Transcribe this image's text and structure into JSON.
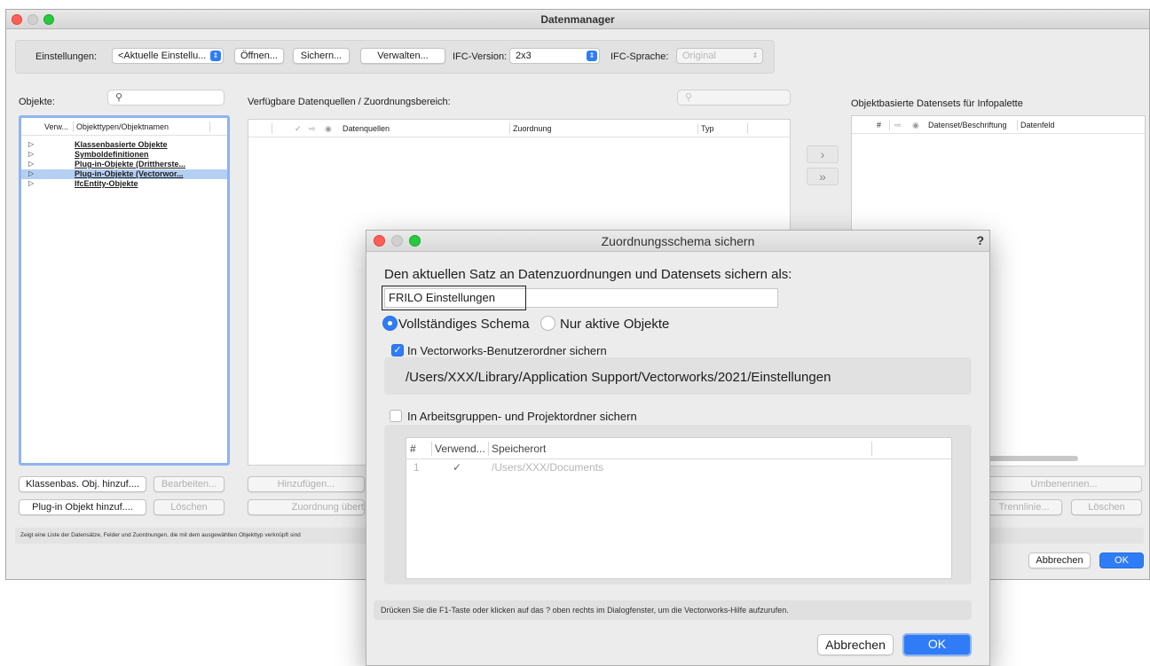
{
  "main_window": {
    "title": "Datenmanager",
    "settings": {
      "label": "Einstellungen:",
      "current": "<Aktuelle Einstellu...",
      "open_label": "Öffnen...",
      "save_label": "Sichern...",
      "manage_label": "Verwalten...",
      "ifc_version_label": "IFC-Version:",
      "ifc_version_value": "2x3",
      "ifc_language_label": "IFC-Sprache:",
      "ifc_language_value": "Original"
    },
    "objects": {
      "label": "Objekte:",
      "col_usage": "Verw...",
      "col_types": "Objekttypen/Objektnamen",
      "items": [
        {
          "name": "Klassenbasierte Objekte"
        },
        {
          "name": "Symboldefinitionen"
        },
        {
          "name": "Plug-in-Objekte (Drittherste..."
        },
        {
          "name": "Plug-in-Objekte (Vectorwor..."
        },
        {
          "name": "IfcEntity-Objekte"
        }
      ],
      "add_class_button": "Klassenbas. Obj. hinzuf....",
      "edit_button": "Bearbeiten...",
      "add_plugin_button": "Plug-in Objekt hinzuf....",
      "delete_button": "Löschen"
    },
    "sources": {
      "label": "Verfügbare Datenquellen / Zuordnungsbereich:",
      "col_sources": "Datenquellen",
      "col_mapping": "Zuordnung",
      "col_type": "Typ",
      "add_button": "Hinzufügen...",
      "transfer_button": "Zuordnung übert"
    },
    "arrows": {
      "single": "›",
      "double": "»"
    },
    "datasets": {
      "label": "Objektbasierte Datensets für Infopalette",
      "col_num": "#",
      "col_caption": "Datenset/Beschriftung",
      "col_field": "Datenfeld",
      "rename_button": "Umbenennen...",
      "separator_button": "Trennlinie...",
      "delete_button": "Löschen"
    },
    "status_text": "Zeigt eine Liste der Datensätze, Felder und Zuordnungen, die mit dem ausgewählten Objekttyp verknüpft sind",
    "cancel_button": "Abbrechen",
    "ok_button": "OK"
  },
  "dialog": {
    "title": "Zuordnungsschema sichern",
    "help": "?",
    "prompt": "Den aktuellen Satz an Datenzuordnungen und Datensets sichern als:",
    "name_value": "FRILO Einstellungen",
    "radio_full": "Vollständiges Schema",
    "radio_active": "Nur aktive Objekte",
    "check_user_folder": "In Vectorworks-Benutzerordner sichern",
    "user_path": "/Users/XXX/Library/Application Support/Vectorworks/2021/Einstellungen",
    "check_workgroup": "In Arbeitsgruppen- und Projektordner sichern",
    "table": {
      "col_num": "#",
      "col_usage": "Verwend...",
      "col_location": "Speicherort",
      "rows": [
        {
          "num": "1",
          "usage": "✓",
          "location": "/Users/XXX/Documents"
        }
      ]
    },
    "status_text": "Drücken Sie die F1-Taste oder klicken auf das ? oben rechts im Dialogfenster, um die Vectorworks-Hilfe aufzurufen.",
    "cancel_button": "Abbrechen",
    "ok_button": "OK"
  }
}
